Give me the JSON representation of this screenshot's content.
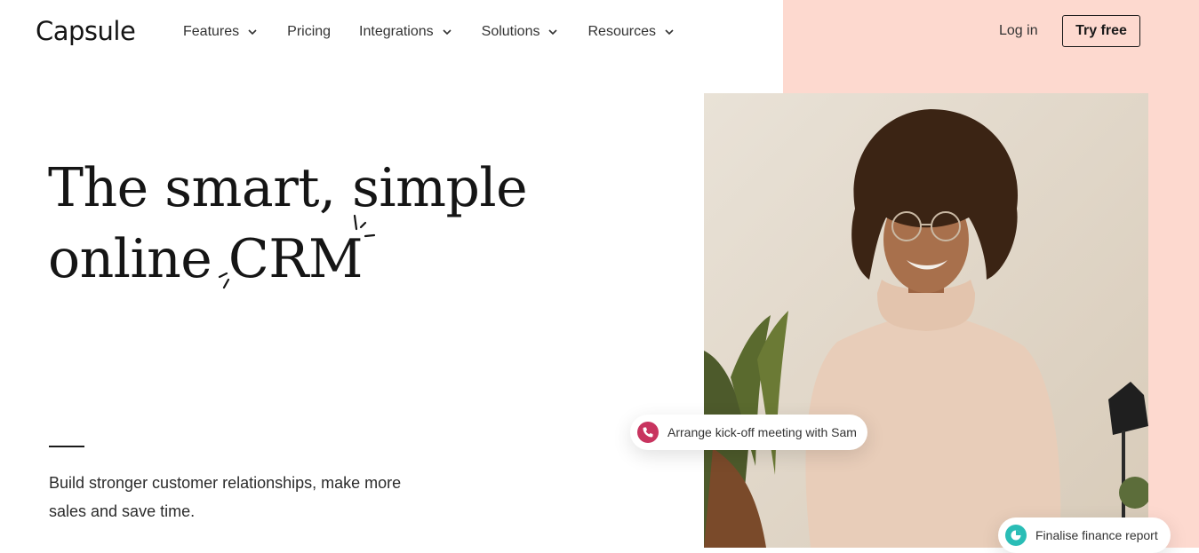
{
  "header": {
    "logo": "Capsule",
    "nav": [
      {
        "label": "Features",
        "has_dropdown": true
      },
      {
        "label": "Pricing",
        "has_dropdown": false
      },
      {
        "label": "Integrations",
        "has_dropdown": true
      },
      {
        "label": "Solutions",
        "has_dropdown": true
      },
      {
        "label": "Resources",
        "has_dropdown": true
      }
    ],
    "login_label": "Log in",
    "cta_label": "Try free"
  },
  "hero": {
    "headline_line1": "The smart, simple",
    "headline_line2_prefix": "online ",
    "headline_line2_emphasis": "CRM",
    "subheading": "Build stronger customer relationships, make more sales and save time."
  },
  "tasks": [
    {
      "label": "Arrange kick-off meeting with Sam",
      "icon": "phone-icon",
      "color": "#c8345f"
    },
    {
      "label": "Finalise finance report",
      "icon": "pie-chart-icon",
      "color": "#2abdb6"
    }
  ],
  "colors": {
    "accent_panel": "#fdd9cf",
    "text": "#151515"
  }
}
